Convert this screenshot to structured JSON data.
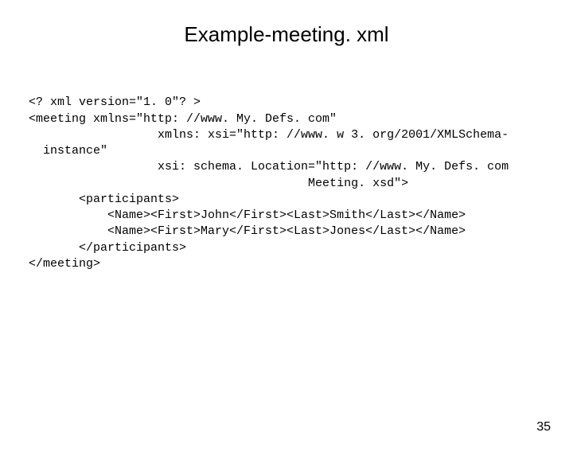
{
  "title": "Example-meeting. xml",
  "code": {
    "l1": "<? xml version=\"1. 0\"? >",
    "l2": "<meeting xmlns=\"http: //www. My. Defs. com\"",
    "l3": "                  xmlns: xsi=\"http: //www. w 3. org/2001/XMLSchema-",
    "l4": "  instance\"",
    "l5": "                  xsi: schema. Location=\"http: //www. My. Defs. com",
    "l6": "                                       Meeting. xsd\">",
    "l7": "       <participants>",
    "l8": "           <Name><First>John</First><Last>Smith</Last></Name>",
    "l9": "           <Name><First>Mary</First><Last>Jones</Last></Name>",
    "l10": "       </participants>",
    "l11": "</meeting>"
  },
  "page_number": "35"
}
